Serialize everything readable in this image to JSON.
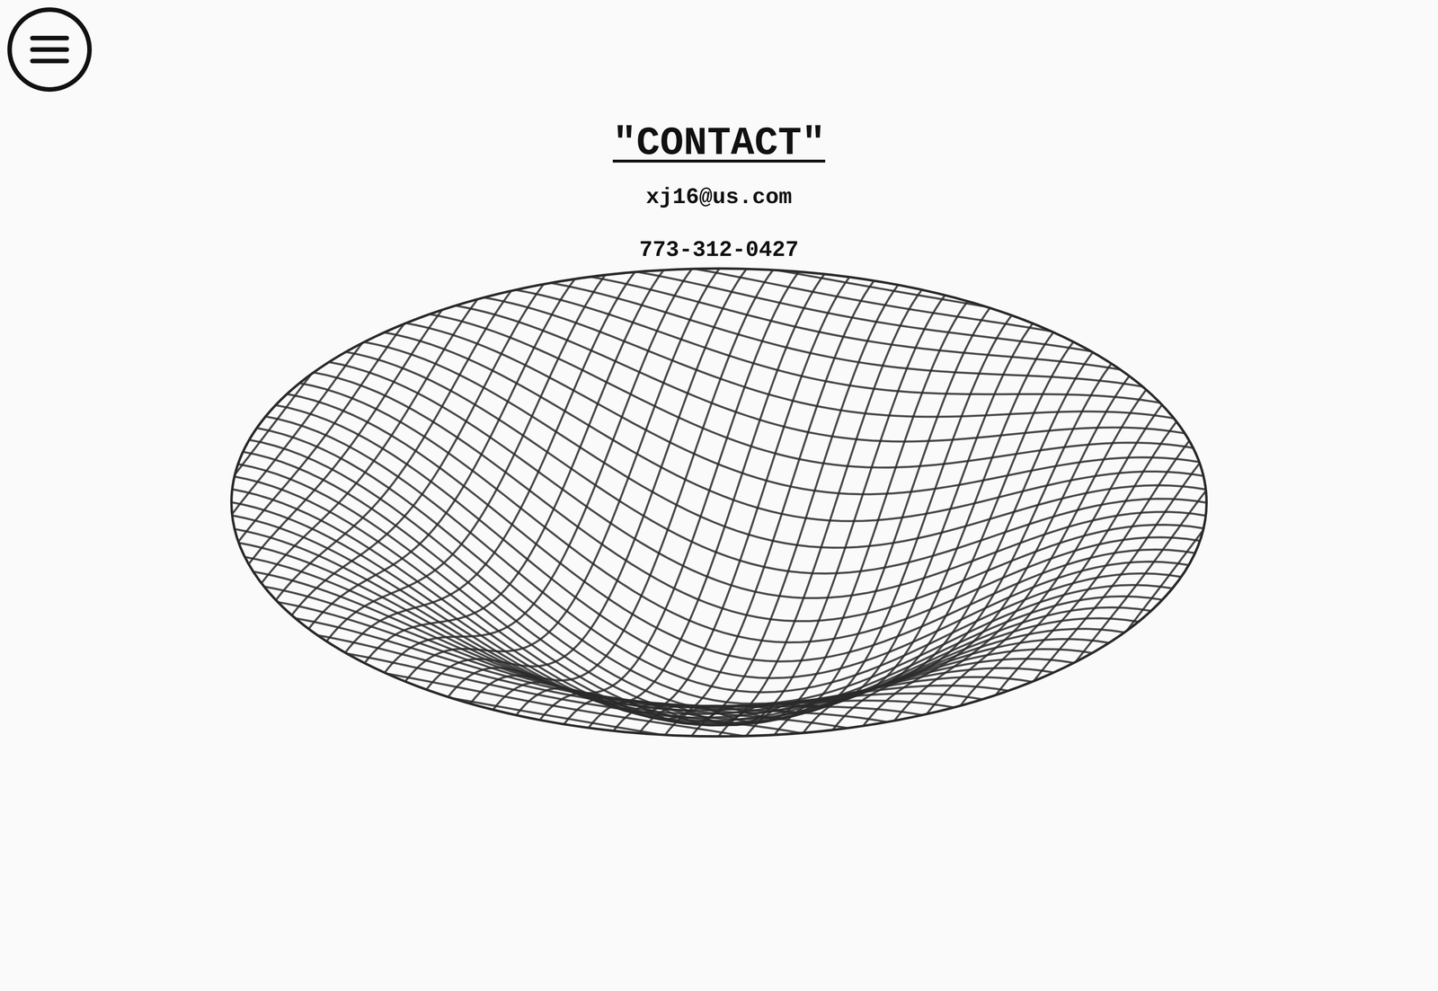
{
  "title": "\"CONTACT\"",
  "contact": {
    "email": "xj16@us.com",
    "phone": "773-312-0427"
  }
}
